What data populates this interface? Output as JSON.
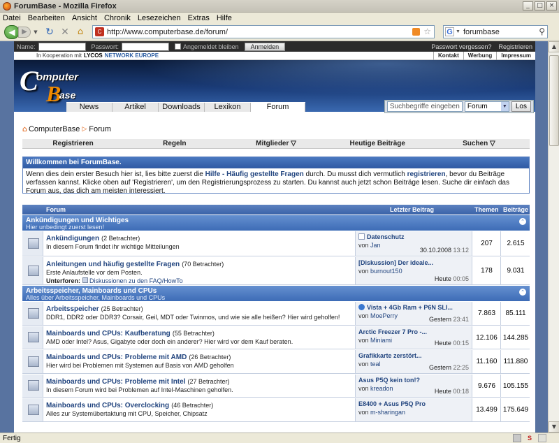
{
  "window": {
    "title": "ForumBase - Mozilla Firefox"
  },
  "menu": [
    "Datei",
    "Bearbeiten",
    "Ansicht",
    "Chronik",
    "Lesezeichen",
    "Extras",
    "Hilfe"
  ],
  "nav": {
    "url": "http://www.computerbase.de/forum/",
    "search_value": "forumbase"
  },
  "status": {
    "text": "Fertig"
  },
  "login": {
    "name_label": "Name:",
    "password_label": "Passwort:",
    "remember_label": "Angemeldet bleiben",
    "submit_label": "Anmelden",
    "forgot_label": "Passwort vergessen?",
    "register_label": "Registrieren"
  },
  "top": {
    "coop_text": "In Kooperation mit",
    "coop_brand": "LYCOS",
    "coop_network": "NETWORK EUROPE",
    "links": [
      "Kontakt",
      "Werbung",
      "Impressum"
    ]
  },
  "logo": {
    "c": "C",
    "omp": "omputer",
    "b": "B",
    "ase": "ase"
  },
  "mainnav": [
    "News",
    "Artikel",
    "Downloads",
    "Lexikon",
    "Forum"
  ],
  "topsearch": {
    "placeholder": "Suchbegriffe eingeben",
    "scope": "Forum",
    "button": "Los"
  },
  "breadcrumb": {
    "home": "ComputerBase",
    "current": "Forum"
  },
  "subnav": [
    "Registrieren",
    "Regeln",
    "Mitglieder ▽",
    "Heutige Beiträge",
    "Suchen ▽"
  ],
  "welcome": {
    "title": "Willkommen bei ForumBase.",
    "p1": "Wenn dies dein erster Besuch hier ist, lies bitte zuerst die ",
    "link1": "Hilfe - Häufig gestellte Fragen",
    "p2": " durch. Du musst dich vermutlich ",
    "link2": "registrieren",
    "p3": ", bevor du Beiträge verfassen kannst. Klicke oben auf 'Registrieren', um den Registrierungsprozess zu starten. Du kannst auch jetzt schon Beiträge lesen. Suche dir einfach das Forum aus, das dich am meisten interessiert."
  },
  "table_head": {
    "forum": "Forum",
    "last": "Letzter Beitrag",
    "threads": "Themen",
    "posts": "Beiträge"
  },
  "categories": [
    {
      "title": "Ankündigungen und Wichtiges",
      "subtitle": "Hier unbedingt zuerst lesen!"
    },
    {
      "title": "Arbeitsspeicher, Mainboards und CPUs",
      "subtitle": "Alles über Arbeitsspeicher, Mainboards und CPUs"
    }
  ],
  "forums": [
    {
      "name": "Ankündigungen",
      "viewers": "(2 Betrachter)",
      "desc": "In diesem Forum findet ihr wichtige Mitteilungen",
      "last_title": "Datenschutz",
      "last_user": "Jan",
      "last_date": "30.10.2008",
      "last_time": "13:12",
      "threads": "207",
      "posts": "2.615"
    },
    {
      "name": "Anleitungen und häufig gestellte Fragen",
      "viewers": "(70 Betrachter)",
      "desc": "Erste Anlaufstelle vor dem Posten.",
      "sub_label": "Unterforen:",
      "sub_link": "Diskussionen zu den FAQ/HowTo",
      "last_title": "[Diskussion] Der ideale...",
      "last_user": "burnout150",
      "last_date": "Heute",
      "last_time": "00:05",
      "threads": "178",
      "posts": "9.031"
    },
    {
      "name": "Arbeitsspeicher",
      "viewers": "(25 Betrachter)",
      "desc": "DDR1, DDR2 oder DDR3? Corsair, Geil, MDT oder Twinmos, und wie sie alle heißen? Hier wird geholfen!",
      "last_title": "Vista + 4Gb Ram + P6N SLI...",
      "last_user": "MoePerry",
      "last_date": "Gestern",
      "last_time": "23:41",
      "threads": "7.863",
      "posts": "85.111"
    },
    {
      "name": "Mainboards und CPUs: Kaufberatung",
      "viewers": "(55 Betrachter)",
      "desc": "AMD oder Intel? Asus, Gigabyte oder doch ein anderer? Hier wird vor dem Kauf beraten.",
      "last_title": "Arctic Freezer 7 Pro -...",
      "last_user": "Miniami",
      "last_date": "Heute",
      "last_time": "00:15",
      "threads": "12.106",
      "posts": "144.285"
    },
    {
      "name": "Mainboards und CPUs: Probleme mit AMD",
      "viewers": "(26 Betrachter)",
      "desc": "Hier wird bei Problemen mit Systemen auf Basis von AMD geholfen",
      "last_title": "Grafikkarte zerstört...",
      "last_user": "teal",
      "last_date": "Gestern",
      "last_time": "22:25",
      "threads": "11.160",
      "posts": "111.880"
    },
    {
      "name": "Mainboards und CPUs: Probleme mit Intel",
      "viewers": "(27 Betrachter)",
      "desc": "In diesem Forum wird bei Problemen auf Intel-Maschinen geholfen.",
      "last_title": "Asus P5Q kein ton!?",
      "last_user": "kreadon",
      "last_date": "Heute",
      "last_time": "00:18",
      "threads": "9.676",
      "posts": "105.155"
    },
    {
      "name": "Mainboards und CPUs: Overclocking",
      "viewers": "(46 Betrachter)",
      "desc": "Alles zur Systemübertaktung mit CPU, Speicher, Chipsatz",
      "last_title": "E8400 + Asus P5Q Pro",
      "last_user": "m-sharingan",
      "threads": "13.499",
      "posts": "175.649"
    }
  ],
  "von_label": "von",
  "colors": {
    "accent": "#3a62a8",
    "link": "#22457f",
    "banner": "#1b3d7a",
    "orange": "#f08a00"
  }
}
